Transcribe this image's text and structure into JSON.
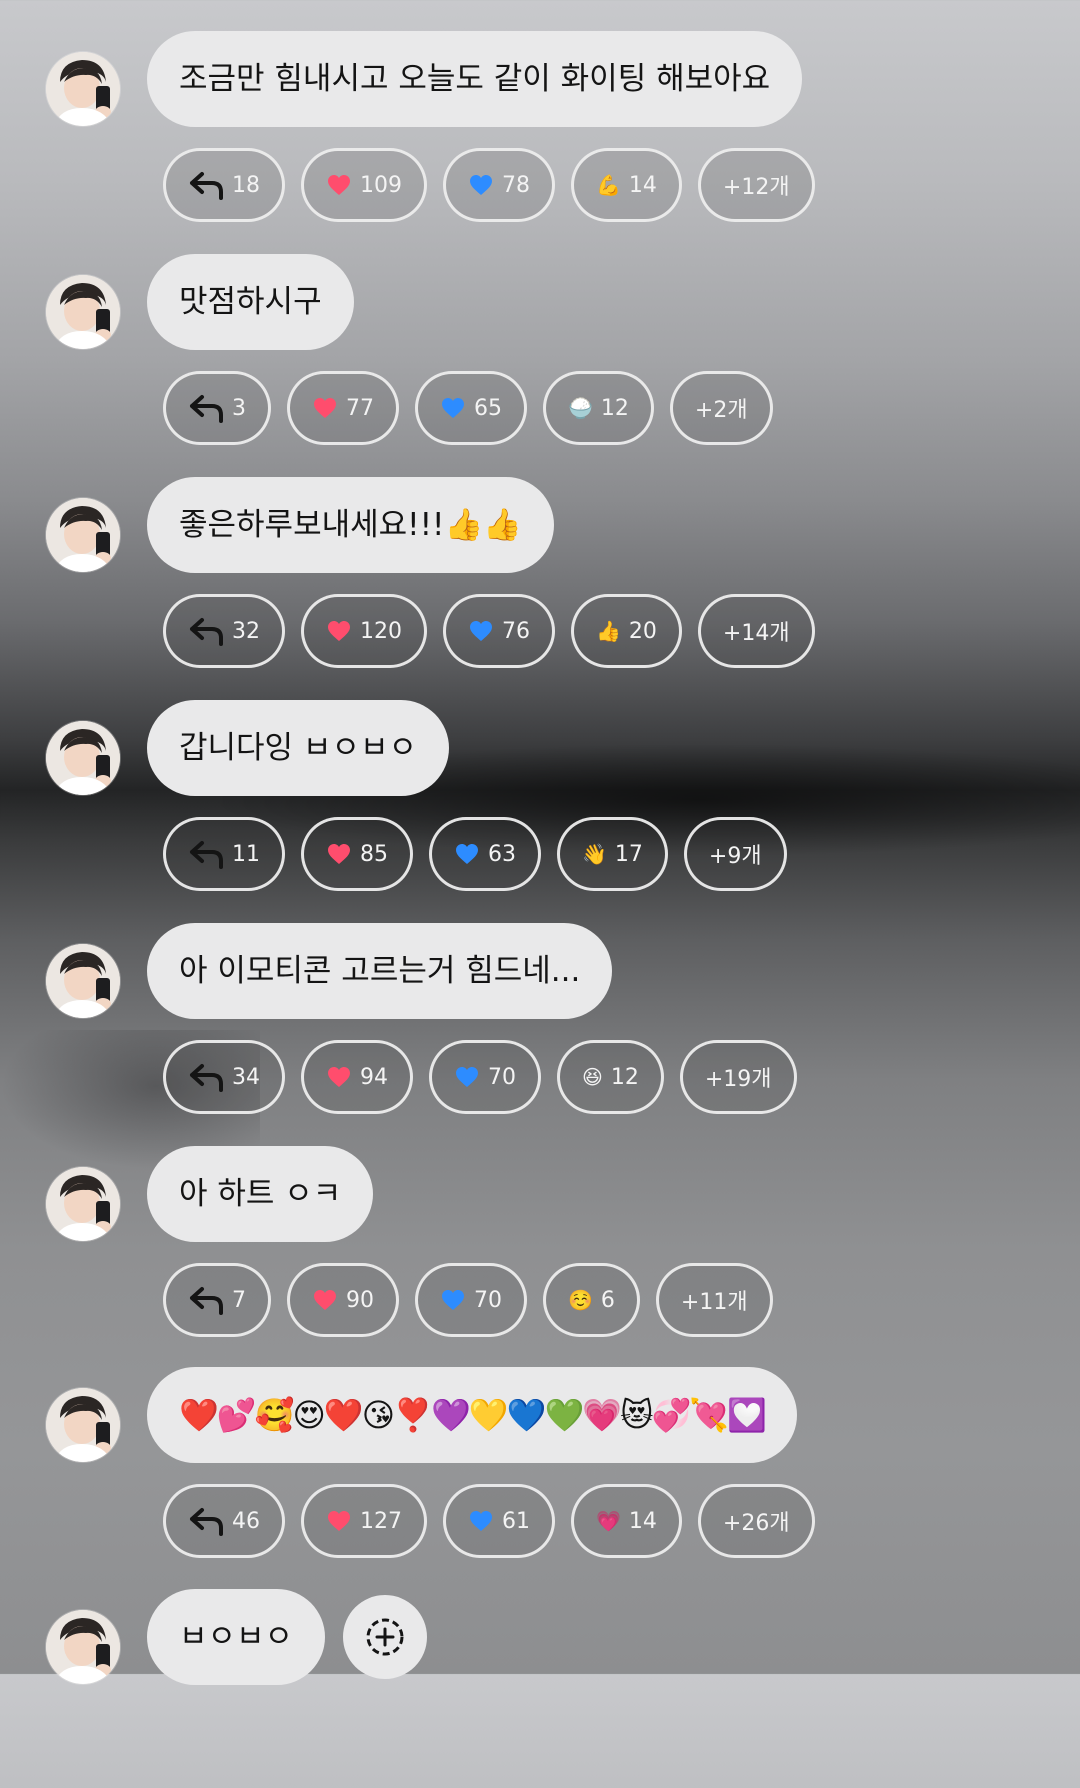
{
  "colors": {
    "bubble": "#e9e9ea",
    "chip_border": "#eeeeee",
    "heart_red": "#ff4d6d",
    "heart_blue": "#2d8cff"
  },
  "messages": [
    {
      "text": "조금만 힘내시고 오늘도 같이 화이팅 해보아요",
      "reactions": {
        "reply": "18",
        "red_heart": "109",
        "blue_heart": "78",
        "emoji_icon": "flexed-biceps",
        "emoji": "💪",
        "emoji_count": "14",
        "more": "+12개"
      }
    },
    {
      "text": "맛점하시구",
      "reactions": {
        "reply": "3",
        "red_heart": "77",
        "blue_heart": "65",
        "emoji_icon": "cooked-rice",
        "emoji": "🍚",
        "emoji_count": "12",
        "more": "+2개"
      }
    },
    {
      "text": "좋은하루보내세요!!!👍👍",
      "reactions": {
        "reply": "32",
        "red_heart": "120",
        "blue_heart": "76",
        "emoji_icon": "thumbs-up",
        "emoji": "👍",
        "emoji_count": "20",
        "more": "+14개"
      }
    },
    {
      "text": "갑니다잉 ㅂㅇㅂㅇ",
      "reactions": {
        "reply": "11",
        "red_heart": "85",
        "blue_heart": "63",
        "emoji_icon": "waving-hand",
        "emoji": "👋",
        "emoji_count": "17",
        "more": "+9개"
      }
    },
    {
      "text": "아 이모티콘 고르는거 힘드네...",
      "reactions": {
        "reply": "34",
        "red_heart": "94",
        "blue_heart": "70",
        "emoji_icon": "grinning-squinting-face",
        "emoji": "😆",
        "emoji_count": "12",
        "more": "+19개"
      }
    },
    {
      "text": "아 하트 ㅇㅋ",
      "reactions": {
        "reply": "7",
        "red_heart": "90",
        "blue_heart": "70",
        "emoji_icon": "smiling-face",
        "emoji": "☺️",
        "emoji_count": "6",
        "more": "+11개"
      }
    },
    {
      "text": "❤️💕🥰😍❤️😘❣️💜💛💙💚💗😻💞💘💟",
      "reactions": {
        "reply": "46",
        "red_heart": "127",
        "blue_heart": "61",
        "emoji_icon": "growing-heart",
        "emoji": "💗",
        "emoji_count": "14",
        "more": "+26개"
      }
    },
    {
      "text": "ㅂㅇㅂㅇ"
    }
  ]
}
